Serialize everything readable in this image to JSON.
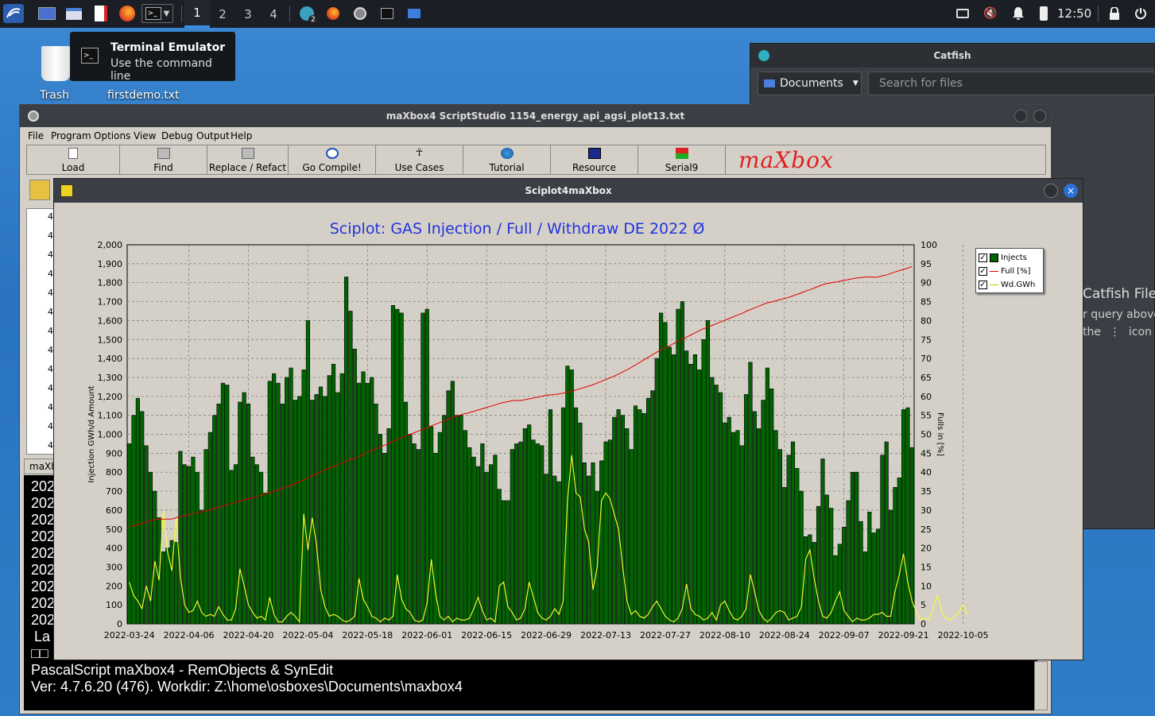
{
  "panel": {
    "workspaces": [
      "1",
      "2",
      "3",
      "4"
    ],
    "active_workspace": "1",
    "clock": "12:50",
    "notification_badge": "2",
    "icons": [
      "kali-menu-icon",
      "show-desktop-icon",
      "file-manager-icon",
      "text-editor-icon",
      "firefox-icon",
      "terminal-icon",
      "display-icon",
      "mute-icon",
      "bell-icon",
      "battery-icon",
      "lock-icon",
      "power-icon"
    ]
  },
  "tooltip": {
    "title": "Terminal Emulator",
    "subtitle": "Use the command line"
  },
  "desktop": {
    "trash_label": "Trash",
    "file_label": "firstdemo.txt"
  },
  "catfish": {
    "title": "Catfish",
    "location": "Documents",
    "search_placeholder": "Search for files",
    "heading": "Catfish File S",
    "line1": "r query above",
    "line2_pre": "the",
    "line2_post": "icon for"
  },
  "maxbox": {
    "title": "maXbox4 ScriptStudio  1154_energy_api_agsi_plot13.txt",
    "menu": [
      "File",
      "Program",
      "Options",
      "View",
      "Debug",
      "Output",
      "Help"
    ],
    "toolbar": [
      "Load",
      "Find",
      "Replace / Refact",
      "Go Compile!",
      "Use Cases",
      "Tutorial",
      "Resource",
      "Serial9"
    ],
    "logo": "maXbox",
    "line_numbers": [
      "4",
      "4",
      "4",
      "4",
      "4",
      "4",
      "4",
      "4",
      "4",
      "4",
      "4",
      "4",
      "4"
    ],
    "tab": "maXb",
    "console": {
      "lines": [
        "202",
        "202",
        "202",
        "202",
        "202",
        "202",
        "202",
        "202",
        "202"
      ],
      "la": "La",
      "boxes": "□□",
      "info1": "PascalScript maXbox4 - RemObjects & SynEdit",
      "info2": "Ver: 4.7.6.20 (476). Workdir: Z:\\home\\osboxes\\Documents\\maxbox4"
    }
  },
  "sciplot": {
    "window_title": "Sciplot4maXbox",
    "close_glyph": "×"
  },
  "chart_data": {
    "type": "bar",
    "title": "Sciplot: GAS Injection / Full / Withdraw DE 2022 Ø",
    "ylabel": "Injection GWh/d Amount",
    "y2label": "Fulls in [%]",
    "ylim": [
      0,
      2000
    ],
    "y2lim": [
      0,
      100
    ],
    "yticks": [
      "0",
      "100",
      "200",
      "300",
      "400",
      "500",
      "600",
      "700",
      "800",
      "900",
      "1,000",
      "1,100",
      "1,200",
      "1,300",
      "1,400",
      "1,500",
      "1,600",
      "1,700",
      "1,800",
      "1,900",
      "2,000"
    ],
    "y2ticks": [
      "0",
      "5",
      "10",
      "15",
      "20",
      "25",
      "30",
      "35",
      "40",
      "45",
      "50",
      "55",
      "60",
      "65",
      "70",
      "75",
      "80",
      "85",
      "90",
      "95",
      "100"
    ],
    "xticks": [
      "2022-03-24",
      "2022-04-06",
      "2022-04-20",
      "2022-05-04",
      "2022-05-18",
      "2022-06-01",
      "2022-06-15",
      "2022-06-29",
      "2022-07-13",
      "2022-07-27",
      "2022-08-10",
      "2022-08-24",
      "2022-09-07",
      "2022-09-21",
      "2022-10-05"
    ],
    "grid": true,
    "legend_position": "top-right",
    "colors": {
      "injects": "#006400",
      "full": "#e00000",
      "withdraw": "#ffff33",
      "title": "#2233dd"
    },
    "series": [
      {
        "name": "Injects",
        "values": [
          950,
          1100,
          1190,
          1120,
          940,
          800,
          700,
          560,
          380,
          400,
          440,
          430,
          910,
          840,
          830,
          880,
          800,
          600,
          920,
          1010,
          1100,
          1160,
          1270,
          1260,
          810,
          840,
          1170,
          1220,
          1160,
          880,
          840,
          800,
          690,
          1280,
          1320,
          1270,
          1160,
          1300,
          1350,
          1180,
          1200,
          1340,
          1600,
          1180,
          1210,
          1250,
          1200,
          1310,
          1370,
          1220,
          1320,
          1830,
          1650,
          1450,
          1270,
          1330,
          1270,
          1300,
          1160,
          1000,
          900,
          1030,
          1680,
          1660,
          1640,
          1170,
          1000,
          950,
          920,
          1640,
          1660,
          1040,
          900,
          1010,
          1100,
          1230,
          1280,
          1100,
          1100,
          1020,
          930,
          880,
          830,
          950,
          800,
          840,
          890,
          710,
          650,
          650,
          920,
          950,
          960,
          1030,
          1050,
          970,
          950,
          940,
          790,
          1130,
          780,
          750,
          1140,
          1360,
          1340,
          1140,
          1060,
          850,
          780,
          850,
          700,
          860,
          960,
          970,
          1090,
          1130,
          1100,
          1030,
          920,
          1150,
          1130,
          1110,
          1190,
          1230,
          1400,
          1640,
          1590,
          1460,
          1420,
          1660,
          1700,
          1440,
          1370,
          1420,
          1340,
          1500,
          1600,
          1300,
          1260,
          1220,
          1060,
          1090,
          1010,
          1020,
          940,
          1210,
          1380,
          1120,
          1030,
          1180,
          1350,
          1240,
          1020,
          920,
          720,
          890,
          960,
          820,
          700,
          460,
          470,
          430,
          620,
          870,
          680,
          610,
          360,
          420,
          510,
          650,
          800,
          800,
          540,
          380,
          590,
          480,
          500,
          890,
          960,
          600,
          720,
          770,
          1130,
          1140,
          930
        ]
      },
      {
        "name": "Full [%]",
        "values": [
          25.5,
          25.8,
          26.1,
          26.4,
          26.7,
          27.0,
          27.3,
          27.5,
          27.6,
          27.6,
          27.6,
          27.6,
          27.8,
          28.2,
          28.4,
          28.6,
          28.8,
          29.0,
          29.3,
          29.5,
          29.7,
          29.9,
          30.2,
          30.5,
          30.8,
          31.1,
          31.4,
          31.7,
          32.0,
          32.2,
          32.5,
          32.8,
          33.1,
          33.3,
          33.6,
          33.9,
          34.2,
          34.5,
          34.8,
          35.1,
          35.4,
          35.8,
          36.1,
          36.5,
          36.9,
          37.4,
          37.8,
          38.3,
          38.8,
          39.2,
          39.6,
          40.1,
          40.6,
          41.0,
          41.4,
          41.8,
          42.2,
          42.6,
          43.0,
          43.4,
          43.7,
          44.1,
          44.6,
          45.1,
          45.6,
          46.0,
          46.4,
          46.8,
          47.2,
          47.6,
          48.1,
          48.5,
          48.9,
          49.3,
          49.7,
          50.1,
          50.5,
          50.9,
          51.3,
          51.7,
          52.1,
          52.5,
          52.9,
          53.3,
          53.7,
          54.1,
          54.5,
          54.8,
          55.1,
          55.4,
          55.6,
          55.9,
          56.2,
          56.5,
          56.8,
          57.1,
          57.4,
          57.7,
          58.0,
          58.3,
          58.5,
          58.7,
          58.9,
          58.9,
          58.9,
          59.1,
          59.3,
          59.5,
          59.7,
          59.9,
          60.1,
          60.3,
          60.4,
          60.5,
          60.6,
          60.8,
          61.0,
          61.2,
          61.5,
          61.8,
          62.1,
          62.4,
          62.7,
          63.0,
          63.4,
          63.8,
          64.2,
          64.6,
          65.0,
          65.4,
          65.9,
          66.4,
          66.9,
          67.4,
          68.0,
          68.6,
          69.2,
          69.8,
          70.4,
          71.0,
          71.6,
          72.1,
          72.6,
          73.1,
          73.6,
          74.1,
          74.6,
          75.1,
          75.6,
          76.1,
          76.6,
          77.1,
          77.6,
          78.0,
          78.4,
          78.8,
          79.2,
          79.6,
          80.0,
          80.4,
          80.8,
          81.2,
          81.6,
          82.0,
          82.5,
          82.9,
          83.3,
          83.7,
          84.1,
          84.5,
          84.8,
          85.0,
          85.3,
          85.6,
          85.8,
          86.1,
          86.4,
          86.8,
          87.1,
          87.5,
          87.9,
          88.2,
          88.6,
          89.0,
          89.4,
          89.7,
          89.9,
          90.1,
          90.2,
          90.4,
          90.6,
          90.8,
          91.0,
          91.2,
          91.3,
          91.4,
          91.5,
          91.5,
          91.4,
          91.5,
          91.8,
          92.0,
          92.3,
          92.7,
          93.0,
          93.3,
          93.6,
          93.9,
          94.3
        ]
      },
      {
        "name": "Wd.GWh",
        "values": [
          220,
          150,
          120,
          80,
          200,
          120,
          330,
          230,
          600,
          380,
          280,
          560,
          250,
          100,
          60,
          70,
          120,
          60,
          40,
          50,
          40,
          90,
          50,
          20,
          20,
          80,
          290,
          200,
          100,
          60,
          30,
          40,
          20,
          140,
          50,
          10,
          10,
          40,
          60,
          40,
          10,
          580,
          390,
          560,
          420,
          180,
          90,
          40,
          50,
          40,
          20,
          10,
          20,
          40,
          240,
          130,
          90,
          40,
          30,
          10,
          30,
          20,
          40,
          260,
          130,
          80,
          60,
          20,
          10,
          20,
          110,
          340,
          160,
          40,
          20,
          40,
          10,
          30,
          20,
          20,
          30,
          80,
          140,
          70,
          20,
          30,
          10,
          200,
          220,
          90,
          60,
          20,
          30,
          80,
          220,
          140,
          60,
          30,
          20,
          40,
          80,
          50,
          120,
          650,
          890,
          690,
          670,
          500,
          430,
          180,
          300,
          650,
          690,
          660,
          580,
          500,
          300,
          120,
          50,
          70,
          40,
          30,
          50,
          90,
          120,
          80,
          40,
          20,
          10,
          30,
          80,
          210,
          80,
          50,
          40,
          20,
          30,
          60,
          20,
          100,
          120,
          70,
          30,
          20,
          40,
          80,
          260,
          170,
          70,
          30,
          10,
          30,
          60,
          70,
          60,
          20,
          30,
          40,
          90,
          340,
          390,
          240,
          120,
          40,
          30,
          60,
          120,
          170,
          70,
          40,
          10,
          30,
          20,
          20,
          30,
          50,
          50,
          60,
          40,
          40,
          170,
          260,
          370,
          220,
          120,
          60,
          20,
          30,
          20,
          90,
          150,
          60,
          30,
          20,
          40,
          60,
          100,
          50
        ]
      }
    ]
  }
}
